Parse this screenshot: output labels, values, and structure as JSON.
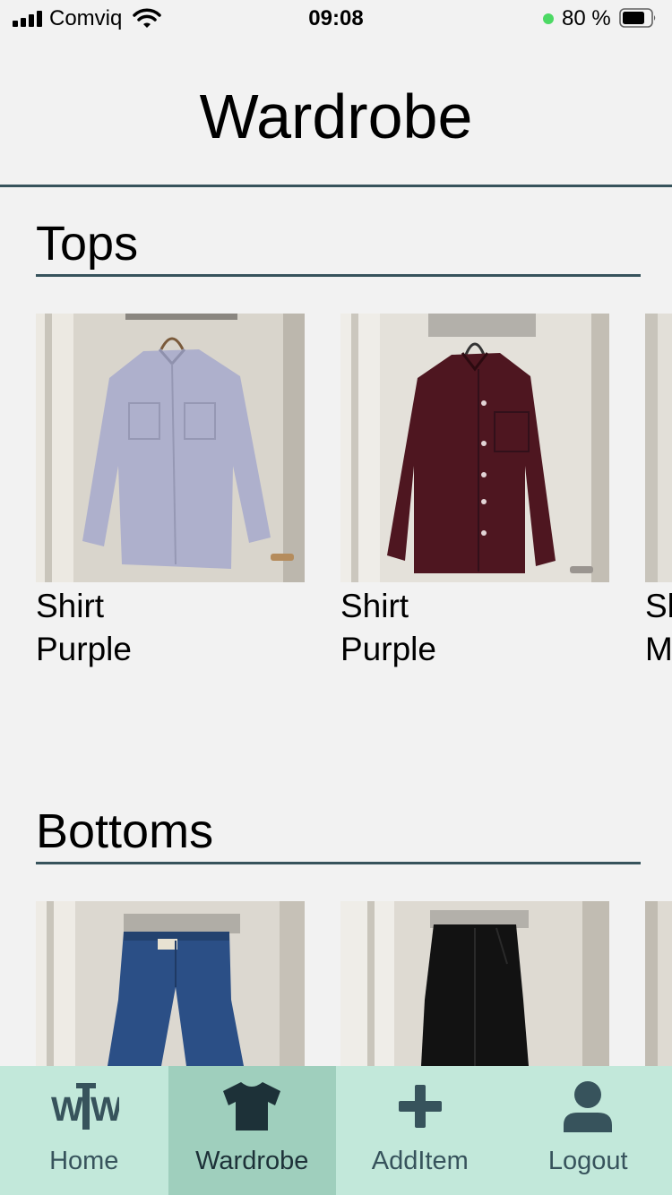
{
  "status_bar": {
    "carrier": "Comviq",
    "time": "09:08",
    "battery_percent": "80 %",
    "battery_level": 0.8,
    "charging_indicator_color": "#4cd964"
  },
  "header": {
    "title": "Wardrobe"
  },
  "sections": [
    {
      "title": "Tops",
      "items": [
        {
          "type": "Shirt",
          "color": "Purple",
          "garment_color": "#aeb0cc",
          "image_icon": "shirt-photo"
        },
        {
          "type": "Shirt",
          "color": "Purple",
          "garment_color": "#4e1620",
          "image_icon": "shirt-photo"
        },
        {
          "type": "Sh",
          "color": "M",
          "image_icon": "shirt-photo"
        }
      ]
    },
    {
      "title": "Bottoms",
      "items": [
        {
          "garment_color": "#2b4f86",
          "image_icon": "jeans-photo"
        },
        {
          "garment_color": "#121212",
          "image_icon": "pants-photo"
        },
        {
          "image_icon": "pants-photo"
        }
      ]
    }
  ],
  "tab_bar": {
    "accent_color": "#37535c",
    "background_color": "#c2e8da",
    "active_color": "#9fcfbd",
    "tabs": [
      {
        "label": "Home",
        "icon": "wtw-logo-icon",
        "active": false
      },
      {
        "label": "Wardrobe",
        "icon": "tshirt-icon",
        "active": true
      },
      {
        "label": "AddItem",
        "icon": "plus-icon",
        "active": false
      },
      {
        "label": "Logout",
        "icon": "user-icon",
        "active": false
      }
    ]
  }
}
